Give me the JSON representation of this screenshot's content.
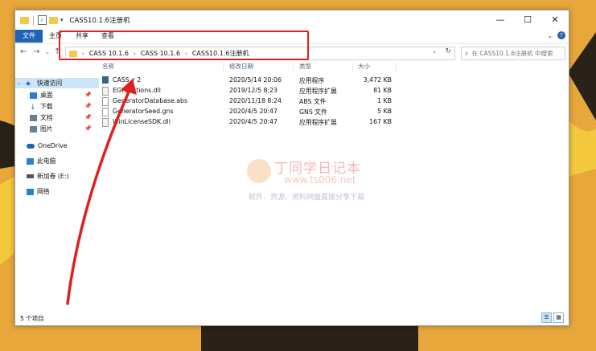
{
  "window": {
    "title": "CASS10.1.6注册机",
    "controls": [
      "—",
      "☐",
      "✕"
    ]
  },
  "ribbon": {
    "tabs": [
      "文件",
      "主页",
      "共享",
      "查看"
    ]
  },
  "address": {
    "crumbs": [
      "CASS 10.1.6",
      "CASS 10.1.6",
      "CASS10.1.6注册机"
    ]
  },
  "search": {
    "placeholder": "在 CASS10.1.6注册机 中搜索"
  },
  "sidebar": {
    "items": [
      {
        "label": "快速访问",
        "icon": "star-icon",
        "color": "#1f64b4"
      },
      {
        "label": "桌面",
        "icon": "desktop-icon",
        "color": "#2b7fd0"
      },
      {
        "label": "下载",
        "icon": "download-icon",
        "color": "#2b7fd0"
      },
      {
        "label": "文档",
        "icon": "document-icon",
        "color": "#6b7d91"
      },
      {
        "label": "图片",
        "icon": "picture-icon",
        "color": "#6b7d91"
      },
      {
        "label": "OneDrive",
        "icon": "cloud-icon",
        "color": "#1f64b4"
      },
      {
        "label": "此电脑",
        "icon": "computer-icon",
        "color": "#2b7fd0"
      },
      {
        "label": "新加卷 (E:)",
        "icon": "drive-icon",
        "color": "#555555"
      },
      {
        "label": "网络",
        "icon": "network-icon",
        "color": "#2b7fd0"
      }
    ]
  },
  "columns": [
    "名称",
    "修改日期",
    "类型",
    "大小"
  ],
  "files": [
    {
      "name": "CASS_r 2",
      "date": "2020/5/14 20:06",
      "type": "应用程序",
      "size": "3,472 KB",
      "icon": "app-icon"
    },
    {
      "name": "EGFunctions.dll",
      "date": "2019/12/5 8:23",
      "type": "应用程序扩展",
      "size": "81 KB",
      "icon": "dll-icon"
    },
    {
      "name": "GeneratorDatabase.abs",
      "date": "2020/11/18 8:24",
      "type": "ABS 文件",
      "size": "1 KB",
      "icon": "file-icon"
    },
    {
      "name": "GeneratorSeed.gns",
      "date": "2020/4/5 20:47",
      "type": "GNS 文件",
      "size": "5 KB",
      "icon": "file-icon"
    },
    {
      "name": "WinLicenseSDK.dll",
      "date": "2020/4/5 20:47",
      "type": "应用程序扩展",
      "size": "167 KB",
      "icon": "dll-icon"
    }
  ],
  "status": {
    "count": "5 个项目"
  },
  "watermark": {
    "title": "丁同学日记本",
    "url": "www.ts006.net",
    "subtitle": "软件、资源、资料网盘直接分享下载"
  }
}
